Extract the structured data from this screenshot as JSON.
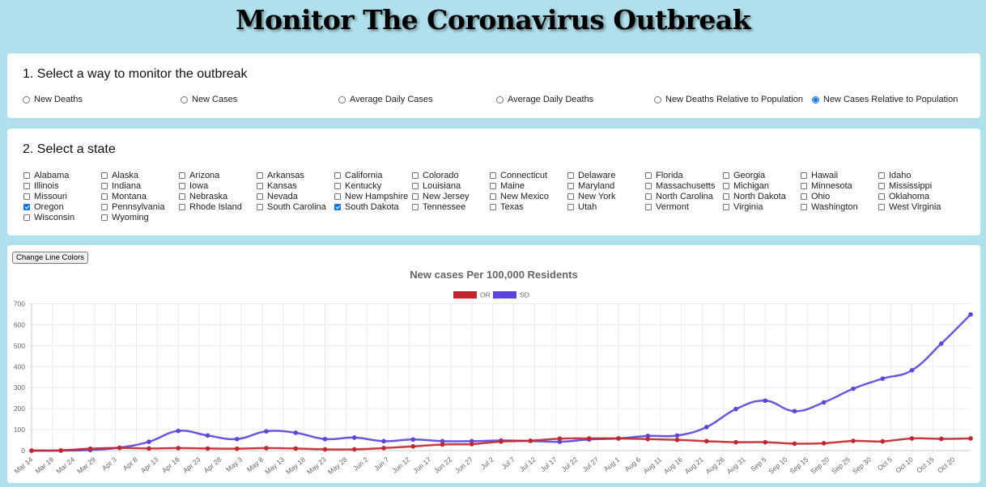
{
  "title": "Monitor The Coronavirus Outbreak",
  "metric_section": {
    "heading": "1. Select a way to monitor the outbreak",
    "options": [
      {
        "label": "New Deaths",
        "checked": false
      },
      {
        "label": "New Cases",
        "checked": false
      },
      {
        "label": "Average Daily Cases",
        "checked": false
      },
      {
        "label": "Average Daily Deaths",
        "checked": false
      },
      {
        "label": "New Deaths Relative to Population",
        "checked": false
      },
      {
        "label": "New Cases Relative to Population",
        "checked": true
      }
    ]
  },
  "state_section": {
    "heading": "2. Select a state",
    "states": [
      {
        "label": "Alabama",
        "checked": false
      },
      {
        "label": "Alaska",
        "checked": false
      },
      {
        "label": "Arizona",
        "checked": false
      },
      {
        "label": "Arkansas",
        "checked": false
      },
      {
        "label": "California",
        "checked": false
      },
      {
        "label": "Colorado",
        "checked": false
      },
      {
        "label": "Connecticut",
        "checked": false
      },
      {
        "label": "Delaware",
        "checked": false
      },
      {
        "label": "Florida",
        "checked": false
      },
      {
        "label": "Georgia",
        "checked": false
      },
      {
        "label": "Hawaii",
        "checked": false
      },
      {
        "label": "Idaho",
        "checked": false
      },
      {
        "label": "Illinois",
        "checked": false
      },
      {
        "label": "Indiana",
        "checked": false
      },
      {
        "label": "Iowa",
        "checked": false
      },
      {
        "label": "Kansas",
        "checked": false
      },
      {
        "label": "Kentucky",
        "checked": false
      },
      {
        "label": "Louisiana",
        "checked": false
      },
      {
        "label": "Maine",
        "checked": false
      },
      {
        "label": "Maryland",
        "checked": false
      },
      {
        "label": "Massachusetts",
        "checked": false
      },
      {
        "label": "Michigan",
        "checked": false
      },
      {
        "label": "Minnesota",
        "checked": false
      },
      {
        "label": "Mississippi",
        "checked": false
      },
      {
        "label": "Missouri",
        "checked": false
      },
      {
        "label": "Montana",
        "checked": false
      },
      {
        "label": "Nebraska",
        "checked": false
      },
      {
        "label": "Nevada",
        "checked": false
      },
      {
        "label": "New Hampshire",
        "checked": false
      },
      {
        "label": "New Jersey",
        "checked": false
      },
      {
        "label": "New Mexico",
        "checked": false
      },
      {
        "label": "New York",
        "checked": false
      },
      {
        "label": "North Carolina",
        "checked": false
      },
      {
        "label": "North Dakota",
        "checked": false
      },
      {
        "label": "Ohio",
        "checked": false
      },
      {
        "label": "Oklahoma",
        "checked": false
      },
      {
        "label": "Oregon",
        "checked": true
      },
      {
        "label": "Pennsylvania",
        "checked": false
      },
      {
        "label": "Rhode Island",
        "checked": false
      },
      {
        "label": "South Carolina",
        "checked": false
      },
      {
        "label": "South Dakota",
        "checked": true
      },
      {
        "label": "Tennessee",
        "checked": false
      },
      {
        "label": "Texas",
        "checked": false
      },
      {
        "label": "Utah",
        "checked": false
      },
      {
        "label": "Vermont",
        "checked": false
      },
      {
        "label": "Virginia",
        "checked": false
      },
      {
        "label": "Washington",
        "checked": false
      },
      {
        "label": "West Virginia",
        "checked": false
      },
      {
        "label": "Wisconsin",
        "checked": false
      },
      {
        "label": "Wyoming",
        "checked": false
      }
    ]
  },
  "chart_section": {
    "change_colors_label": "Change Line Colors"
  },
  "chart_data": {
    "type": "line",
    "title": "New cases Per 100,000 Residents",
    "xlabel": "",
    "ylabel": "",
    "ylim": [
      0,
      700
    ],
    "yticks": [
      0,
      100,
      200,
      300,
      400,
      500,
      600,
      700
    ],
    "grid": true,
    "legend_position": "top-center",
    "x_start": "2020-03-14",
    "x_end": "2020-10-24",
    "xtick_labels": [
      "Mar 14",
      "Mar 19",
      "Mar 24",
      "Mar 29",
      "Apr 3",
      "Apr 8",
      "Apr 13",
      "Apr 18",
      "Apr 23",
      "Apr 28",
      "May 3",
      "May 8",
      "May 13",
      "May 18",
      "May 23",
      "May 28",
      "Jun 2",
      "Jun 7",
      "Jun 12",
      "Jun 17",
      "Jun 22",
      "Jun 27",
      "Jul 2",
      "Jul 7",
      "Jul 12",
      "Jul 17",
      "Jul 22",
      "Jul 27",
      "Aug 1",
      "Aug 6",
      "Aug 11",
      "Aug 16",
      "Aug 21",
      "Aug 26",
      "Aug 31",
      "Sep 5",
      "Sep 10",
      "Sep 15",
      "Sep 20",
      "Sep 25",
      "Sep 30",
      "Oct 5",
      "Oct 10",
      "Oct 15",
      "Oct 20"
    ],
    "x": [
      "Mar 14",
      "Mar 21",
      "Mar 28",
      "Apr 4",
      "Apr 11",
      "Apr 18",
      "Apr 25",
      "May 2",
      "May 9",
      "May 16",
      "May 23",
      "May 30",
      "Jun 6",
      "Jun 13",
      "Jun 20",
      "Jun 27",
      "Jul 4",
      "Jul 11",
      "Jul 18",
      "Jul 25",
      "Aug 1",
      "Aug 8",
      "Aug 15",
      "Aug 22",
      "Aug 29",
      "Sep 5",
      "Sep 12",
      "Sep 19",
      "Sep 26",
      "Oct 3",
      "Oct 10",
      "Oct 17",
      "Oct 24"
    ],
    "series": [
      {
        "name": "OR",
        "color": "#c1272d",
        "values": [
          0,
          1,
          9,
          13,
          10,
          12,
          10,
          9,
          12,
          10,
          6,
          6,
          12,
          20,
          29,
          31,
          43,
          47,
          57,
          58,
          58,
          55,
          51,
          45,
          40,
          40,
          33,
          35,
          46,
          44,
          58,
          56,
          58
        ]
      },
      {
        "name": "SD",
        "color": "#5b45dc",
        "values": [
          0,
          0,
          3,
          14,
          42,
          94,
          72,
          55,
          92,
          85,
          55,
          62,
          45,
          53,
          45,
          45,
          48,
          46,
          42,
          53,
          58,
          70,
          72,
          112,
          198,
          238,
          188,
          230,
          295,
          343,
          383,
          510,
          649
        ]
      }
    ]
  }
}
